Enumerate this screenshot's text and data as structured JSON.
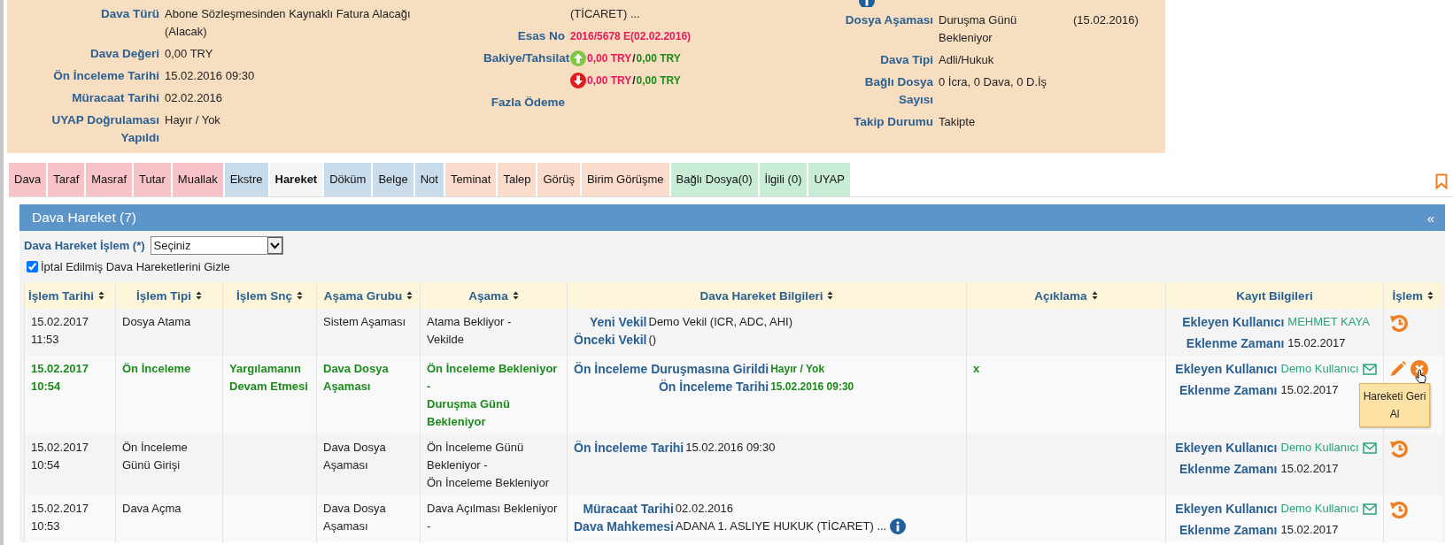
{
  "case_info": {
    "left": [
      {
        "label": "Dava Türü",
        "value": "Abone Sözleşmesinden Kaynaklı Fatura Alacağı (Alacak)"
      },
      {
        "label": "Dava Değeri",
        "value": "0,00 TRY"
      },
      {
        "label": "Ön İnceleme Tarihi",
        "value": "15.02.2016 09:30"
      },
      {
        "label": "Müracaat Tarihi",
        "value": "02.02.2016"
      },
      {
        "label": "UYAP Doğrulaması Yapıldı",
        "value": "Hayır / Yok"
      }
    ],
    "middle": {
      "court_tail": "(TİCARET) ...",
      "esas_no": {
        "label": "Esas No",
        "value": "2016/5678 E(02.02.2016)"
      },
      "balance": {
        "label": "Bakiye/Tahsilat",
        "lines": [
          {
            "kind": "up",
            "balance": "0,00 TRY",
            "separator": "/",
            "collected": "0,00 TRY"
          },
          {
            "kind": "down",
            "balance": "0,00 TRY",
            "separator": "/",
            "collected": "0,00 TRY"
          }
        ]
      },
      "overpayment": {
        "label": "Fazla Ödeme"
      }
    },
    "right": [
      {
        "label": "Dosya Aşaması",
        "value": "Duruşma Günü Bekleniyor",
        "note": "(15.02.2016)"
      },
      {
        "label": "Dava Tipi",
        "value": "Adli/Hukuk"
      },
      {
        "label": "Bağlı Dosya Sayısı",
        "value": "0 İcra, 0 Dava, 0 D.İş"
      },
      {
        "label": "Takip Durumu",
        "value": "Takipte"
      }
    ]
  },
  "tabs": [
    {
      "label": "Dava",
      "color": "#f8c3c8",
      "selected": false
    },
    {
      "label": "Taraf",
      "color": "#f8c3c8",
      "selected": false
    },
    {
      "label": "Masraf",
      "color": "#f8c3c8",
      "selected": false
    },
    {
      "label": "Tutar",
      "color": "#f8c3c8",
      "selected": false
    },
    {
      "label": "Muallak",
      "color": "#f8c3c8",
      "selected": false
    },
    {
      "label": "Ekstre",
      "color": "#c9dcec",
      "selected": false
    },
    {
      "label": "Hareket",
      "color": "#f4f4f4",
      "selected": true
    },
    {
      "label": "Döküm",
      "color": "#c9dcec",
      "selected": false
    },
    {
      "label": "Belge",
      "color": "#c9dcec",
      "selected": false
    },
    {
      "label": "Not",
      "color": "#c9dcec",
      "selected": false
    },
    {
      "label": "Teminat",
      "color": "#f9dccb",
      "selected": false
    },
    {
      "label": "Talep",
      "color": "#f9dccb",
      "selected": false
    },
    {
      "label": "Görüş",
      "color": "#f9dccb",
      "selected": false
    },
    {
      "label": "Birim Görüşme",
      "color": "#f9dccb",
      "selected": false
    },
    {
      "label": "Bağlı Dosya(0)",
      "color": "#c8ecd6",
      "selected": false
    },
    {
      "label": "İlgili (0)",
      "color": "#c8ecd6",
      "selected": false
    },
    {
      "label": "UYAP",
      "color": "#c8ecd6",
      "selected": false
    }
  ],
  "panel": {
    "title": "Dava Hareket (7)",
    "collapse": "«",
    "action_field": {
      "label": "Dava Hareket İşlem (*)",
      "value": "Seçiniz"
    },
    "hide_cancelled": {
      "label": "İptal Edilmiş Dava Hareketlerini Gizle",
      "checked": true
    }
  },
  "table": {
    "columns": [
      {
        "label": "İşlem Tarihi",
        "sortable": true
      },
      {
        "label": "İşlem Tipi",
        "sortable": true
      },
      {
        "label": "İşlem Snç",
        "sortable": true
      },
      {
        "label": "Aşama Grubu",
        "sortable": true
      },
      {
        "label": "Aşama",
        "sortable": true
      },
      {
        "label": "Dava Hareket Bilgileri",
        "sortable": true
      },
      {
        "label": "Açıklama",
        "sortable": true
      },
      {
        "label": "Kayıt Bilgileri",
        "sortable": false
      },
      {
        "label": "İşlem",
        "sortable": true
      }
    ],
    "rows": [
      {
        "active": false,
        "date": "15.02.2017 11:53",
        "type": "Dosya Atama",
        "result": "",
        "stage_group": "Sistem Aşaması",
        "stage": [
          "Atama Bekliyor -",
          "Vekilde"
        ],
        "details": [
          {
            "label": "Yeni Vekil",
            "value": "Demo Vekil (ICR, ADC, AHI)"
          },
          {
            "label": "Önceki Vekil",
            "value": "()"
          }
        ],
        "note": "",
        "record": {
          "user_label": "Ekleyen Kullanıcı",
          "user": "MEHMET KAYA",
          "mail": false,
          "time_label": "Eklenme Zamanı",
          "time": "15.02.2017"
        },
        "actions": [
          {
            "kind": "undo"
          }
        ]
      },
      {
        "active": true,
        "date": "15.02.2017 10:54",
        "type": "Ön İnceleme",
        "result": "Yargılamanın Devam Etmesi",
        "stage_group": "Dava Dosya Aşaması",
        "stage": [
          "Ön İnceleme Bekleniyor -",
          "Duruşma Günü Bekleniyor"
        ],
        "details": [
          {
            "label": "Ön İnceleme Duruşmasına Girildi",
            "value": "Hayır / Yok"
          },
          {
            "label": "Ön İnceleme Tarihi",
            "value": "15.02.2016 09:30"
          }
        ],
        "note": "x",
        "record": {
          "user_label": "Ekleyen Kullanıcı",
          "user": "Demo Kullanıcı",
          "mail": true,
          "time_label": "Eklenme Zamanı",
          "time": "15.02.2017"
        },
        "actions": [
          {
            "kind": "edit"
          },
          {
            "kind": "cancel",
            "hovered": true,
            "tooltip": "Hareketi Geri Al"
          }
        ]
      },
      {
        "active": false,
        "date": "15.02.2017 10:54",
        "type": "Ön İnceleme Günü Girişi",
        "result": "",
        "stage_group": "Dava Dosya Aşaması",
        "stage": [
          "Ön İnceleme Günü Bekleniyor -",
          "Ön İnceleme Bekleniyor"
        ],
        "details": [
          {
            "label": "Ön İnceleme Tarihi",
            "value": "15.02.2016 09:30"
          }
        ],
        "note": "",
        "record": {
          "user_label": "Ekleyen Kullanıcı",
          "user": "Demo Kullanıcı",
          "mail": true,
          "time_label": "Eklenme Zamanı",
          "time": "15.02.2017"
        },
        "actions": [
          {
            "kind": "undo"
          }
        ]
      },
      {
        "active": false,
        "date": "15.02.2017 10:53",
        "type": "Dava Açma",
        "result": "",
        "stage_group": "Dava Dosya Aşaması",
        "stage": [
          "Dava Açılması Bekleniyor -"
        ],
        "details": [
          {
            "label": "Müracaat Tarihi",
            "value": "02.02.2016"
          },
          {
            "label": "Dava Mahkemesi",
            "value": "ADANA 1. ASLIYE HUKUK (TİCARET) ...",
            "info": true
          }
        ],
        "note": "",
        "record": {
          "user_label": "Ekleyen Kullanıcı",
          "user": "Demo Kullanıcı",
          "mail": true,
          "time_label": "Eklenme Zamanı",
          "time": "15.02.2017"
        },
        "actions": [
          {
            "kind": "undo"
          }
        ]
      }
    ]
  }
}
